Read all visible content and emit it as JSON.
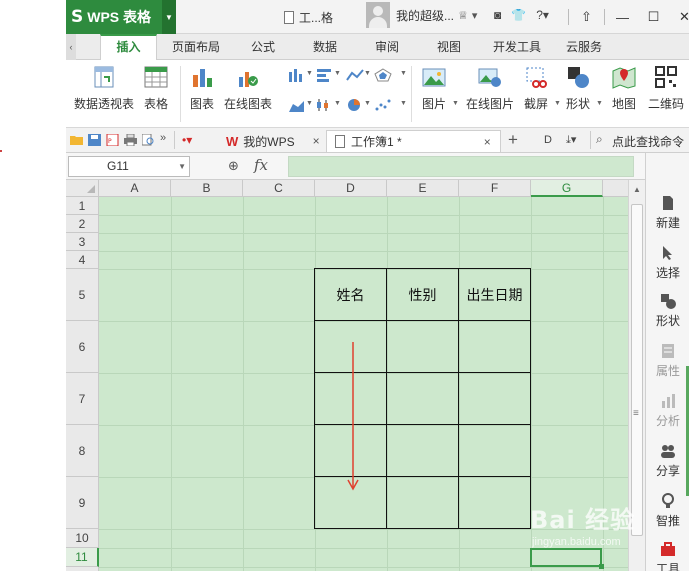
{
  "app": {
    "name": "WPS 表格",
    "logo_letter": "S",
    "doc_title": "工...格",
    "user_name": "我的超级...",
    "colors": {
      "brand_green": "#2e8b3e",
      "cell_bg": "#cde8cd",
      "red_arrow": "#e0412f"
    }
  },
  "ribbon_tabs": [
    "插入",
    "页面布局",
    "公式",
    "数据",
    "审阅",
    "视图",
    "开发工具",
    "云服务"
  ],
  "toolbar": {
    "pivot_label": "数据透视表",
    "table_label": "表格",
    "chart_label": "图表",
    "online_chart_label": "在线图表",
    "picture_label": "图片",
    "online_picture_label": "在线图片",
    "screenshot_label": "截屏",
    "shape_label": "形状",
    "map_label": "地图",
    "qrcode_label": "二维码"
  },
  "doc_tabs": {
    "mywps_label": "我的WPS",
    "workbook_label": "工作簿1 *",
    "search_label": "点此查找命令"
  },
  "formula_bar": {
    "cell_ref": "G11",
    "fx_label": "fx",
    "value": ""
  },
  "grid": {
    "columns": [
      "A",
      "B",
      "C",
      "D",
      "E",
      "F",
      "G"
    ],
    "rows": [
      "1",
      "2",
      "3",
      "4",
      "5",
      "6",
      "7",
      "8",
      "9",
      "10",
      "11"
    ],
    "selected_column": "G",
    "selected_row": "11",
    "table_headers": [
      "姓名",
      "性别",
      "出生日期"
    ]
  },
  "right_pane": [
    {
      "label": "新建",
      "icon": "new-icon"
    },
    {
      "label": "选择",
      "icon": "select-icon"
    },
    {
      "label": "形状",
      "icon": "shape-icon"
    },
    {
      "label": "属性",
      "icon": "property-icon"
    },
    {
      "label": "分析",
      "icon": "analysis-icon"
    },
    {
      "label": "分享",
      "icon": "share-icon"
    },
    {
      "label": "智推",
      "icon": "smart-icon"
    },
    {
      "label": "工具",
      "icon": "tools-icon"
    }
  ],
  "watermark": {
    "text": "Bai 经验",
    "sub": "jingyan.baidu.com"
  }
}
